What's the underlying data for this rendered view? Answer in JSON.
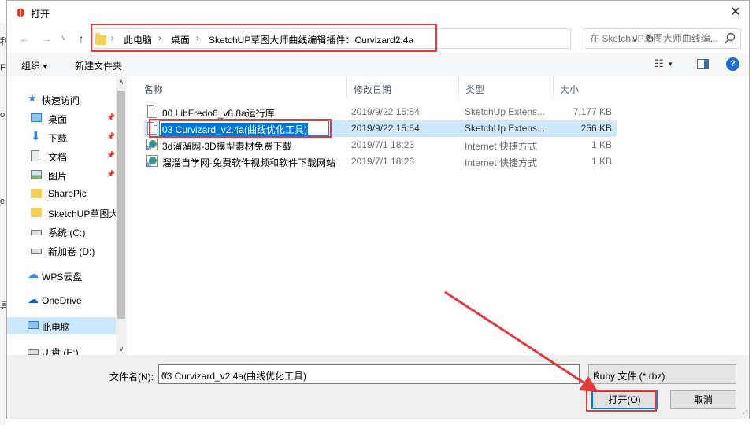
{
  "window": {
    "title": "打开"
  },
  "nav": {
    "crumbs": [
      "此电脑",
      "桌面",
      "SketchUP草图大师曲线编辑插件：Curvizard2.4a"
    ],
    "search_placeholder": "在 SketchUP草图大师曲线编..."
  },
  "toolbar": {
    "organize": "组织 ▾",
    "new_folder": "新建文件夹"
  },
  "sidebar": {
    "items": [
      {
        "label": "快速访问",
        "icon": "star-icon",
        "pinned": false
      },
      {
        "label": "桌面",
        "icon": "desktop-icon",
        "pinned": true
      },
      {
        "label": "下载",
        "icon": "download-icon",
        "pinned": true
      },
      {
        "label": "文档",
        "icon": "document-icon",
        "pinned": true
      },
      {
        "label": "图片",
        "icon": "picture-icon",
        "pinned": true
      },
      {
        "label": "SharePic",
        "icon": "folder-icon",
        "pinned": false
      },
      {
        "label": "SketchUP草图大",
        "icon": "folder-icon",
        "pinned": false
      },
      {
        "label": "系统 (C:)",
        "icon": "drive-icon",
        "pinned": false
      },
      {
        "label": "新加卷 (D:)",
        "icon": "drive-icon",
        "pinned": false
      },
      {
        "label": "WPS云盘",
        "icon": "cloud-icon",
        "pinned": false
      },
      {
        "label": "OneDrive",
        "icon": "onedrive-icon",
        "pinned": false
      },
      {
        "label": "此电脑",
        "icon": "pc-icon",
        "pinned": false
      },
      {
        "label": "U 盘 (E:)",
        "icon": "usb-drive-icon",
        "pinned": false
      }
    ]
  },
  "columns": {
    "name": "名称",
    "date": "修改日期",
    "type": "类型",
    "size": "大小"
  },
  "files": [
    {
      "name": "00 LibFredo6_v8.8a运行库",
      "date": "2019/9/22 15:54",
      "type": "SketchUp Extens...",
      "size": "7,177 KB",
      "icon": "file-icon"
    },
    {
      "name": "03 Curvizard_v2.4a(曲线优化工具)",
      "date": "2019/9/22 15:54",
      "type": "SketchUp Extens...",
      "size": "256 KB",
      "icon": "file-icon"
    },
    {
      "name": "3d溜溜网-3D模型素材免费下载",
      "date": "2019/7/1 18:23",
      "type": "Internet 快捷方式",
      "size": "1 KB",
      "icon": "link-icon"
    },
    {
      "name": "溜溜自学网-免费软件视频和软件下载网站",
      "date": "2019/7/1 18:23",
      "type": "Internet 快捷方式",
      "size": "1 KB",
      "icon": "link-icon"
    }
  ],
  "footer": {
    "filename_label": "文件名(N):",
    "filename_value": "03 Curvizard_v2.4a(曲线优化工具)",
    "filetype": "Ruby 文件 (*.rbz)",
    "open_button": "打开(O)",
    "cancel_button": "取消"
  },
  "colors": {
    "annotation": "#e23a3a",
    "selection": "#cce8ff",
    "accent": "#0078d7"
  }
}
